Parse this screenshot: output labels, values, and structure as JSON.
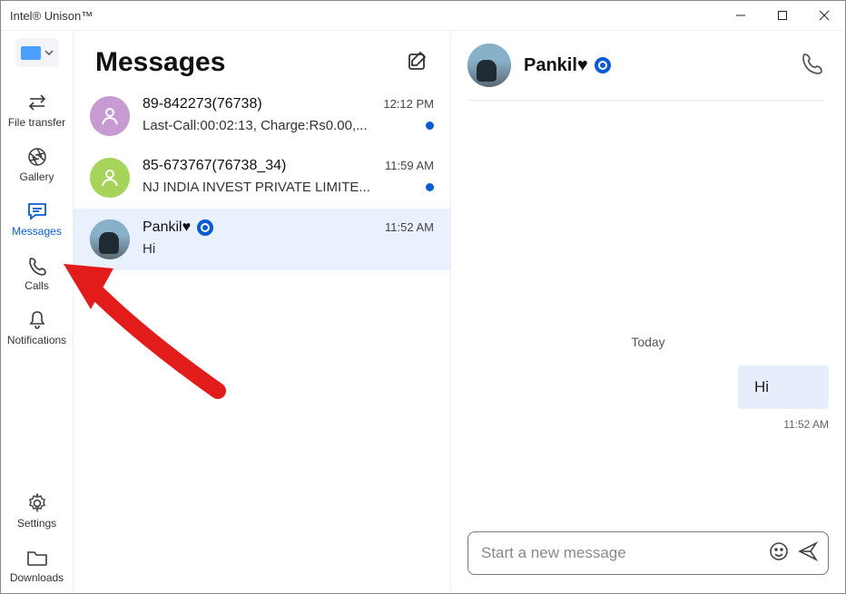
{
  "window": {
    "title": "Intel® Unison™"
  },
  "sidebar": {
    "items": [
      {
        "label": "File transfer"
      },
      {
        "label": "Gallery"
      },
      {
        "label": "Messages"
      },
      {
        "label": "Calls"
      },
      {
        "label": "Notifications"
      }
    ],
    "footer": [
      {
        "label": "Settings"
      },
      {
        "label": "Downloads"
      }
    ]
  },
  "list": {
    "title": "Messages",
    "threads": [
      {
        "name": "89-842273(76738)",
        "time": "12:12 PM",
        "snippet": "Last-Call:00:02:13, Charge:Rs0.00,...",
        "unread": true,
        "avatar": "purple"
      },
      {
        "name": "85-673767(76738_34)",
        "time": "11:59 AM",
        "snippet": "NJ INDIA INVEST PRIVATE LIMITE...",
        "unread": true,
        "avatar": "green"
      },
      {
        "name": "Pankil♥",
        "time": "11:52 AM",
        "snippet": "Hi",
        "unread": false,
        "avatar": "photo",
        "has_eye": true,
        "active": true
      }
    ]
  },
  "chat": {
    "contact_name": "Pankil♥",
    "date_separator": "Today",
    "messages": [
      {
        "text": "Hi",
        "time": "11:52 AM",
        "outgoing": true
      }
    ],
    "input_placeholder": "Start a new message"
  }
}
